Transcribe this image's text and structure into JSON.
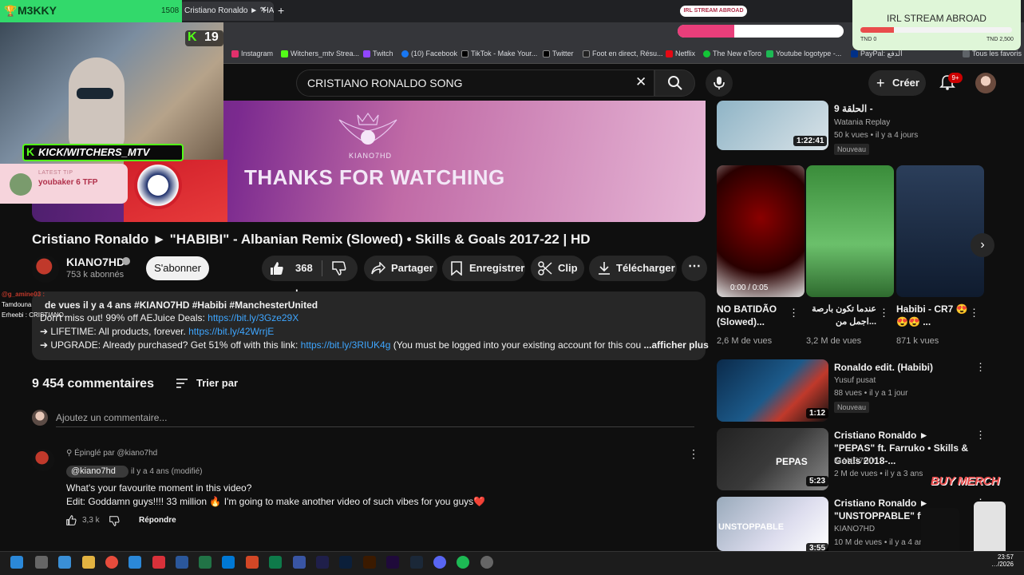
{
  "browser": {
    "tab_title": "Cristiano Ronaldo ► \"HA",
    "bookmarks": [
      "Instagram",
      "Witchers_mtv Strea...",
      "Twitch",
      "(10) Facebook",
      "TikTok - Make Your...",
      "Twitter",
      "Foot en direct, Résu...",
      "Netflix",
      "The New eToro",
      "Youtube logotype -...",
      "PayPal: الدفع",
      "Tous les favoris"
    ]
  },
  "youtube": {
    "search_value": "CRISTIANO RONALDO SONG",
    "create_label": "Créer",
    "notif_badge": "9+",
    "video_overlay_text": "THANKS FOR WATCHING",
    "video_logo_text": "KIANO7HD",
    "video_title": "Cristiano Ronaldo ► \"HABIBI\" - Albanian Remix (Slowed) • Skills & Goals 2017-22 | HD",
    "channel": {
      "name": "KIANO7HD",
      "subs": "753 k abonnés",
      "subscribe_label": "S'abonner"
    },
    "actions": {
      "likes": "368 k",
      "share": "Partager",
      "save": "Enregistrer",
      "clip": "Clip",
      "download": "Télécharger"
    },
    "description": {
      "line0": "de vues  il y a 4 ans  #KIANO7HD #Habibi #ManchesterUnited",
      "line1_text": "Don't miss out! 99% off AEJuice Deals: ",
      "line1_link": "https://bit.ly/3Gze29X",
      "line2_text": "➔ LIFETIME: All products, forever. ",
      "line2_link": "https://bit.ly/42WrrjE",
      "line3_text": "➔ UPGRADE:  Already purchased? Get 51% off with this link: ",
      "line3_link": "https://bit.ly/3RIUK4g",
      "line3_tail": "  (You must be logged into your existing account for this cou",
      "more": " ...afficher plus"
    },
    "comments": {
      "count": "9 454 commentaires",
      "sort_label": "Trier par",
      "add_placeholder": "Ajoutez un commentaire...",
      "pinned_by": "Épinglé par @kiano7hd",
      "author": "@kiano7hd",
      "date": "il y a 4 ans (modifié)",
      "line1": "What's your favourite moment in this video?",
      "line2": "Edit: Goddamn guys!!!! 33 million 🔥 I'm going to make another video of such vibes for you guys❤️",
      "likes": "3,3 k",
      "reply": "Répondre"
    },
    "sidebar": {
      "top": {
        "title": "الحلقة 9 -",
        "channel": "Watania Replay",
        "meta": "50 k vues • il y a 4 jours",
        "badge": "Nouveau",
        "duration": "1:22:41"
      },
      "shorts": [
        {
          "title": "NO BATIDÃO (Slowed)...",
          "views": "2,6 M de vues",
          "thumb_text": "0:00 / 0:05"
        },
        {
          "title": "عندما تكون بارصة اجمل من...",
          "views": "3,2 M de vues",
          "thumb_text": ""
        },
        {
          "title": "Habibi - CR7 😍😍😍 ...",
          "views": "871 k vues",
          "thumb_text": ""
        }
      ],
      "list": [
        {
          "title": "Ronaldo edit.      (Habibi)",
          "channel": "Yusuf pusat",
          "meta": "88 vues • il y a 1 jour",
          "badge": "Nouveau",
          "duration": "1:12"
        },
        {
          "title": "Cristiano Ronaldo ► \"PEPAS\" ft. Farruko • Skills & Goals 2018-...",
          "channel": "KIANO7HD",
          "meta": "2 M de vues • il y a 3 ans",
          "duration": "5:23",
          "thumb_text": "PEPAS"
        },
        {
          "title": "Cristiano Ronaldo ► \"UNSTOPPABLE\" ft.",
          "channel": "KIANO7HD",
          "meta": "10 M de vues • il y a 4 ans",
          "duration": "3:55",
          "thumb_text": "UNSTOPPABLE"
        }
      ]
    }
  },
  "stream": {
    "trophy_name": "M3KKY",
    "trophy_num": "1508",
    "kick_viewers": "19",
    "kick_handle": "KICK/WITCHERS_MTV",
    "tip_label": "LATEST TIP",
    "tip_text": "youbaker 6 TFP",
    "chat": [
      "@g_amine03 :",
      "Tamdouna",
      "Erheebi : CRISTIANO..."
    ],
    "irl_small": "IRL STREAM ABROAD",
    "irl_title": "IRL STREAM ABROAD",
    "irl_min": "TND 0",
    "irl_max": "TND 2,500",
    "irl_progress": 0.22,
    "irl_small_progress": 0.34,
    "buy_merch": "BUY MERCH"
  },
  "taskbar": {
    "time": "23:57",
    "date": "…/2026"
  },
  "colors": {
    "bg": "#0f0f0f",
    "link": "#3ea6ff",
    "kick": "#53fc18",
    "notif": "#cc0000"
  }
}
